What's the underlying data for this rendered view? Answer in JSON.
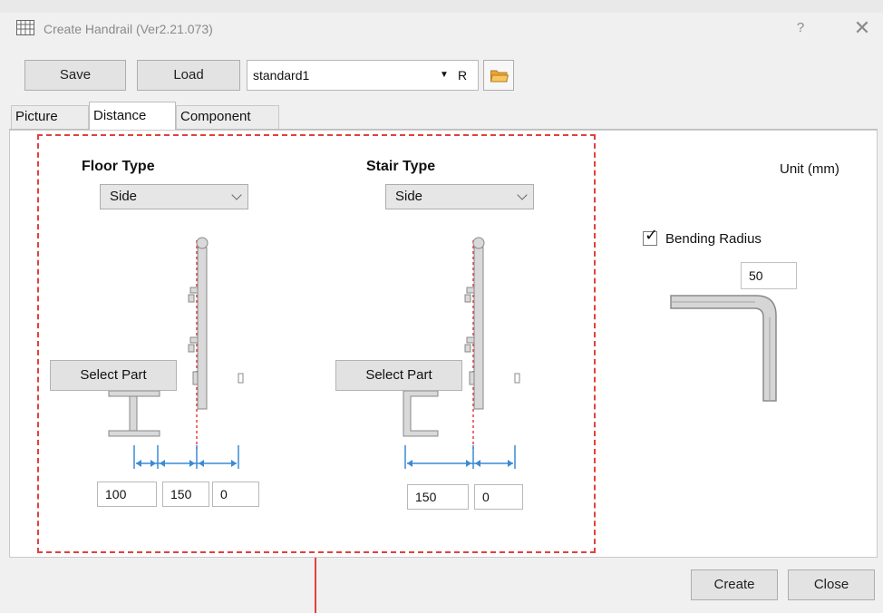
{
  "window": {
    "title": "Create Handrail (Ver2.21.073)",
    "help_label": "?",
    "close_label": "✕"
  },
  "toolbar": {
    "save_label": "Save",
    "load_label": "Load",
    "preset_value": "standard1",
    "preset_suffix": "R"
  },
  "tabs": [
    {
      "label": "Picture"
    },
    {
      "label": "Distance",
      "active": true
    },
    {
      "label": "Component"
    }
  ],
  "unit_label": "Unit (mm)",
  "floor": {
    "header": "Floor Type",
    "type_value": "Side",
    "select_part_label": "Select Part",
    "distances": [
      "100",
      "150",
      "0"
    ]
  },
  "stair": {
    "header": "Stair Type",
    "type_value": "Side",
    "select_part_label": "Select Part",
    "distances": [
      "150",
      "0"
    ]
  },
  "bending": {
    "label": "Bending Radius",
    "checked": true,
    "value": "50"
  },
  "footer": {
    "create_label": "Create",
    "close_label": "Close"
  },
  "colors": {
    "highlight_dash": "#e0413f",
    "dimension_blue": "#3a8ad6",
    "folder_orange": "#e8a43a"
  }
}
